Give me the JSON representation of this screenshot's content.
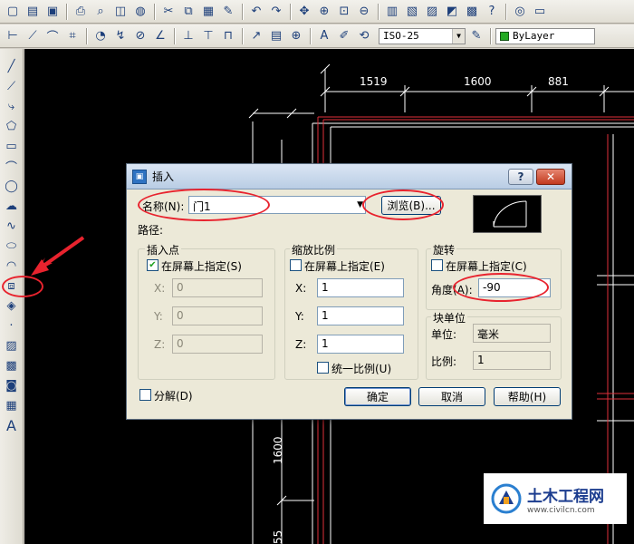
{
  "toolbar": {
    "dimstyle": "ISO-25",
    "layer": "ByLayer"
  },
  "drawing": {
    "dims": [
      "1519",
      "1600",
      "881",
      "1600",
      "55"
    ]
  },
  "dialog": {
    "title": "插入",
    "help_button": "?",
    "close_button": "✕",
    "name_label": "名称(N):",
    "name_value": "门1",
    "browse_button": "浏览(B)...",
    "path_label": "路径:",
    "insertion": {
      "title": "插入点",
      "specify_on_screen": "在屏幕上指定(S)",
      "x_label": "X:",
      "x_value": "0",
      "y_label": "Y:",
      "y_value": "0",
      "z_label": "Z:",
      "z_value": "0"
    },
    "scale": {
      "title": "缩放比例",
      "specify_on_screen": "在屏幕上指定(E)",
      "x_label": "X:",
      "x_value": "1",
      "y_label": "Y:",
      "y_value": "1",
      "z_label": "Z:",
      "z_value": "1",
      "uniform_scale": "统一比例(U)"
    },
    "rotation": {
      "title": "旋转",
      "specify_on_screen": "在屏幕上指定(C)",
      "angle_label": "角度(A):",
      "angle_value": "-90"
    },
    "block_unit": {
      "title": "块单位",
      "unit_label": "单位:",
      "unit_value": "毫米",
      "factor_label": "比例:",
      "factor_value": "1"
    },
    "explode": "分解(D)",
    "ok_button": "确定",
    "cancel_button": "取消",
    "help_button_text": "帮助(H)"
  },
  "watermark": {
    "title": "土木工程网",
    "url": "www.civilcn.com"
  }
}
